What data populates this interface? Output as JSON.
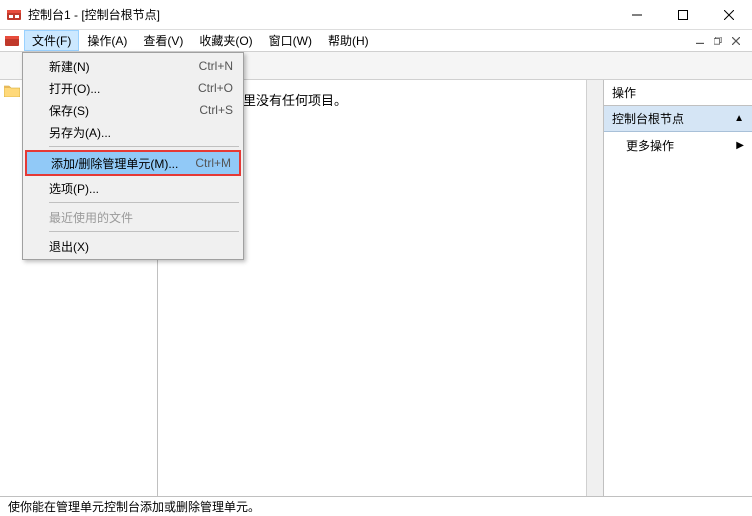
{
  "window": {
    "title": "控制台1 - [控制台根节点]"
  },
  "menubar": {
    "items": [
      {
        "label": "文件(F)"
      },
      {
        "label": "操作(A)"
      },
      {
        "label": "查看(V)"
      },
      {
        "label": "收藏夹(O)"
      },
      {
        "label": "窗口(W)"
      },
      {
        "label": "帮助(H)"
      }
    ]
  },
  "file_menu": {
    "new": {
      "label": "新建(N)",
      "shortcut": "Ctrl+N"
    },
    "open": {
      "label": "打开(O)...",
      "shortcut": "Ctrl+O"
    },
    "save": {
      "label": "保存(S)",
      "shortcut": "Ctrl+S"
    },
    "save_as": {
      "label": "另存为(A)..."
    },
    "add_remove": {
      "label": "添加/删除管理单元(M)...",
      "shortcut": "Ctrl+M"
    },
    "options": {
      "label": "选项(P)..."
    },
    "recent": {
      "label": "最近使用的文件"
    },
    "exit": {
      "label": "退出(X)"
    }
  },
  "main": {
    "empty_text": "这里没有任何项目。"
  },
  "actions": {
    "header": "操作",
    "section": "控制台根节点",
    "more": "更多操作"
  },
  "statusbar": {
    "text": "使你能在管理单元控制台添加或删除管理单元。"
  }
}
